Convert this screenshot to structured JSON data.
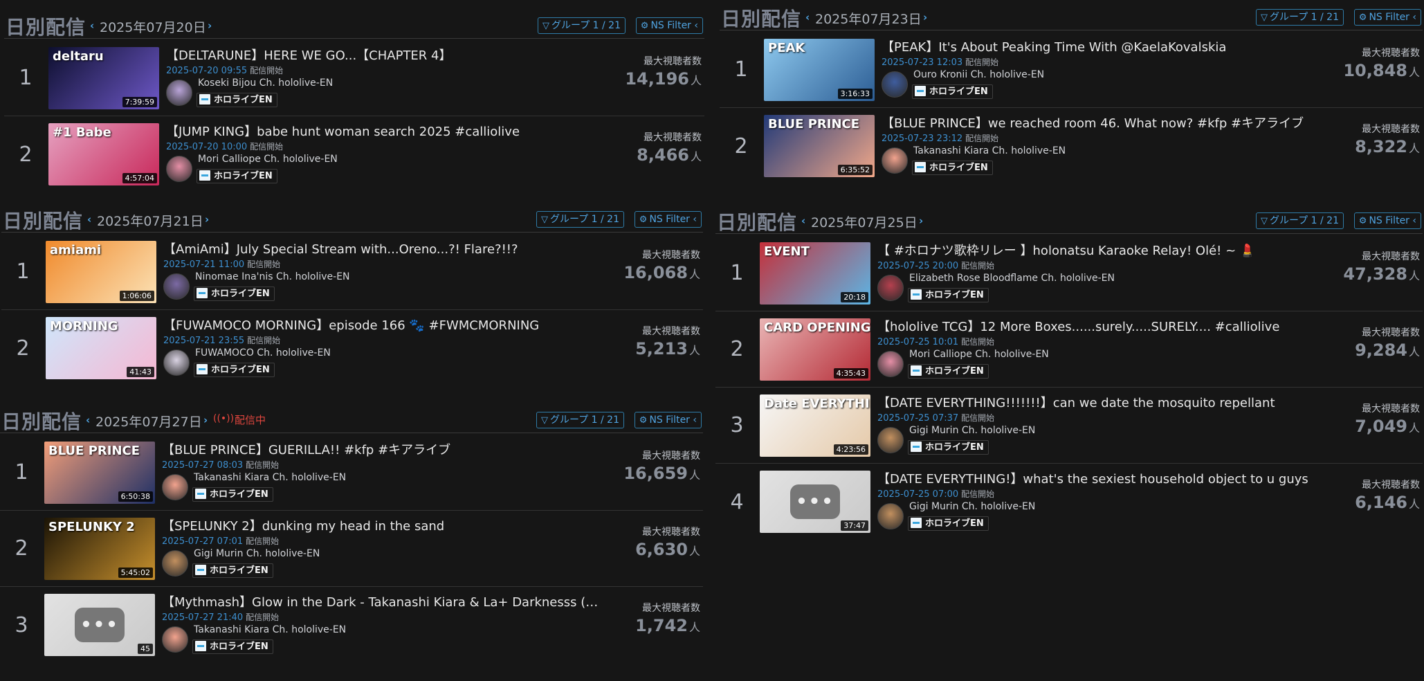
{
  "common": {
    "section_title": "日別配信",
    "group_filter": "グループ 1 / 21",
    "ns_filter": "NS Filter",
    "viewer_label": "最大視聴者数",
    "viewer_unit": "人",
    "start_label": "配信開始",
    "live_label": "配信中"
  },
  "sections": [
    {
      "date": "2025年07月20日",
      "items": [
        {
          "rank": "1",
          "title": "【DELTARUNE】HERE WE GO...【CHAPTER 4】",
          "time": "2025-07-20 09:55",
          "channel": "Koseki Bijou Ch. hololive-EN",
          "tag": "ホロライブEN",
          "duration": "7:39:59",
          "viewers": "14,196",
          "thumb_text": "deltaru",
          "thumb_colors": [
            "#0d0f2e",
            "#6e58c8"
          ],
          "avatar_color": "#b9a4d8"
        },
        {
          "rank": "2",
          "title": "【JUMP KING】babe hunt woman search 2025 #calliolive",
          "time": "2025-07-20 10:00",
          "channel": "Mori Calliope Ch. hololive-EN",
          "tag": "ホロライブEN",
          "duration": "4:57:04",
          "viewers": "8,466",
          "thumb_text": "#1 Babe",
          "thumb_colors": [
            "#e5a1c0",
            "#c8285a"
          ],
          "avatar_color": "#e58fa6"
        }
      ]
    },
    {
      "date": "2025年07月21日",
      "items": [
        {
          "rank": "1",
          "title": "【AmiAmi】July Special Stream with...Oreno...?! Flare?!!?",
          "time": "2025-07-21 11:00",
          "channel": "Ninomae Ina'nis Ch. hololive-EN",
          "tag": "ホロライブEN",
          "duration": "1:06:06",
          "viewers": "16,068",
          "thumb_text": "amiami",
          "thumb_colors": [
            "#f08a2c",
            "#fbe2b6"
          ],
          "avatar_color": "#7c6aa4"
        },
        {
          "rank": "2",
          "title": "【FUWAMOCO MORNING】episode 166 🐾 #FWMCMORNING",
          "time": "2025-07-21 23:55",
          "channel": "FUWAMOCO Ch. hololive-EN",
          "tag": "ホロライブEN",
          "duration": "41:43",
          "viewers": "5,213",
          "thumb_text": "MORNING",
          "thumb_colors": [
            "#cfe6fb",
            "#f6b7d2"
          ],
          "avatar_color": "#d9d2e2"
        }
      ]
    },
    {
      "date": "2025年07月27日",
      "live": true,
      "items": [
        {
          "rank": "1",
          "title": "【BLUE PRINCE】GUERILLA!! #kfp #キアライブ",
          "time": "2025-07-27 08:03",
          "channel": "Takanashi Kiara Ch. hololive-EN",
          "tag": "ホロライブEN",
          "duration": "6:50:38",
          "viewers": "16,659",
          "thumb_text": "BLUE PRINCE",
          "thumb_colors": [
            "#f29e79",
            "#1d2f66"
          ],
          "avatar_color": "#f2a38e"
        },
        {
          "rank": "2",
          "title": "【SPELUNKY 2】dunking my head in the sand",
          "time": "2025-07-27 07:01",
          "channel": "Gigi Murin Ch. hololive-EN",
          "tag": "ホロライブEN",
          "duration": "5:45:02",
          "viewers": "6,630",
          "thumb_text": "SPELUNKY 2",
          "thumb_colors": [
            "#1b1406",
            "#c7902d"
          ],
          "avatar_color": "#c2905f"
        },
        {
          "rank": "3",
          "title": "【Mythmash】Glow in the Dark - Takanashi Kiara & La+ Darknesss (Official …",
          "time": "2025-07-27 21:40",
          "channel": "Takanashi Kiara Ch. hololive-EN",
          "tag": "ホロライブEN",
          "duration": "45",
          "viewers": "1,742",
          "placeholder": "•••",
          "thumb_colors": [
            "#e2e2e2",
            "#c9c9c9"
          ],
          "avatar_color": "#f2a38e"
        }
      ]
    },
    {
      "date": "2025年07月23日",
      "items": [
        {
          "rank": "1",
          "title": "【PEAK】It's About Peaking Time With @KaelaKovalskia",
          "time": "2025-07-23 12:03",
          "channel": "Ouro Kronii Ch. hololive-EN",
          "tag": "ホロライブEN",
          "duration": "3:16:33",
          "viewers": "10,848",
          "thumb_text": "PEAK",
          "thumb_colors": [
            "#8ec9ee",
            "#2c5d94"
          ],
          "avatar_color": "#3f5d9e"
        },
        {
          "rank": "2",
          "title": "【BLUE PRINCE】we reached room 46. What now? #kfp #キアライブ",
          "time": "2025-07-23 23:12",
          "channel": "Takanashi Kiara Ch. hololive-EN",
          "tag": "ホロライブEN",
          "duration": "6:35:52",
          "viewers": "8,322",
          "thumb_text": "BLUE PRINCE",
          "thumb_colors": [
            "#223a78",
            "#f2a889"
          ],
          "avatar_color": "#f2a38e"
        }
      ]
    },
    {
      "date": "2025年07月25日",
      "items": [
        {
          "rank": "1",
          "title": "【 #ホロナツ歌枠リレー 】holonatsu Karaoke Relay! Olé! ~ 💄",
          "time": "2025-07-25 20:00",
          "channel": "Elizabeth Rose Bloodflame Ch. hololive-EN",
          "tag": "ホロライブEN",
          "duration": "20:18",
          "viewers": "47,328",
          "thumb_text": "EVENT",
          "thumb_colors": [
            "#c5303a",
            "#5bb6e6"
          ],
          "avatar_color": "#b5404e"
        },
        {
          "rank": "2",
          "title": "【hololive TCG】12 More Boxes......surely.....SURELY.... #calliolive",
          "time": "2025-07-25 10:01",
          "channel": "Mori Calliope Ch. hololive-EN",
          "tag": "ホロライブEN",
          "duration": "4:35:43",
          "viewers": "9,284",
          "thumb_text": "CARD OPENING",
          "thumb_colors": [
            "#e9b4b4",
            "#b42a35"
          ],
          "avatar_color": "#e58fa6"
        },
        {
          "rank": "3",
          "title": "【DATE EVERYTHING!!!!!!!】can we date the mosquito repellant",
          "time": "2025-07-25 07:37",
          "channel": "Gigi Murin Ch. hololive-EN",
          "tag": "ホロライブEN",
          "duration": "4:23:56",
          "viewers": "7,049",
          "thumb_text": "Date EVERYTHING!",
          "thumb_colors": [
            "#f6f6f6",
            "#e5c9a8"
          ],
          "avatar_color": "#c2905f"
        },
        {
          "rank": "4",
          "title": "【DATE EVERYTHING!】what's the sexiest household object to u guys",
          "time": "2025-07-25 07:00",
          "channel": "Gigi Murin Ch. hololive-EN",
          "tag": "ホロライブEN",
          "duration": "37:47",
          "viewers": "6,146",
          "placeholder": "•••",
          "thumb_colors": [
            "#e2e2e2",
            "#c9c9c9"
          ],
          "avatar_color": "#c2905f"
        }
      ]
    }
  ]
}
